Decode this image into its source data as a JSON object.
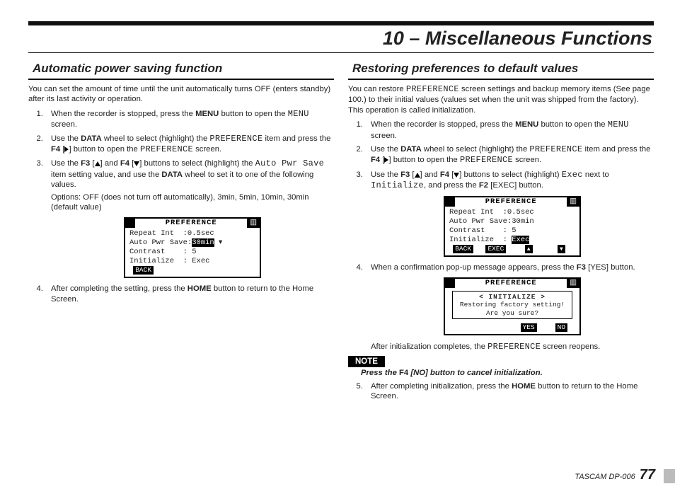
{
  "page_title": "10 – Miscellaneous Functions",
  "footer_model": "TASCAM  DP-006",
  "footer_page": "77",
  "left": {
    "heading": "Automatic power saving function",
    "intro": "You can set the amount of time until the unit automatically turns OFF (enters standby) after its last activity or operation.",
    "step1a": "When the recorder is stopped, press the ",
    "step1_menu": "MENU",
    "step1b": " button to open the ",
    "step1_lcd": "MENU",
    "step1c": " screen.",
    "step2a": "Use the ",
    "step2_data": "DATA",
    "step2b": " wheel to select (highlight) the ",
    "step2_pref": "PREFERENCE",
    "step2c": " item and press the ",
    "step2_f4": "F4",
    "step2d": " [",
    "step2e": "] button to open the ",
    "step2_pref2": "PREFERENCE",
    "step2f": " screen.",
    "step3a": "Use the ",
    "step3_f3": "F3",
    "step3b": " [",
    "step3c": "] and ",
    "step3_f4": "F4",
    "step3d": " [",
    "step3e": "] buttons to select (highlight) the ",
    "step3_aps": "Auto Pwr Save",
    "step3f": " item setting value, and use the ",
    "step3_data": "DATA",
    "step3g": " wheel to set it to one of the following values.",
    "step3_options": "Options: OFF (does not turn off automatically), 3min, 5min, 10min, 30min (default value)",
    "step4a": "After completing the setting, press the ",
    "step4_home": "HOME",
    "step4b": " button to return to the Home Screen.",
    "lcd": {
      "title": "PREFERENCE",
      "r1": "Repeat Int  :0.5sec",
      "r2a": "Auto Pwr Save:",
      "r2b": "30min",
      "r3": "Contrast    : 5",
      "r4": "Initialize  : Exec",
      "f1": "BACK"
    }
  },
  "right": {
    "heading": "Restoring preferences to default values",
    "intro1": "You can restore ",
    "intro_pref": "PREFERENCE",
    "intro2": " screen settings and backup memory items (See page 100.) to their initial values (values set when the unit was shipped from the factory). This operation is called initialization.",
    "step1a": "When the recorder is stopped, press the ",
    "step1_menu": "MENU",
    "step1b": " button to open the ",
    "step1_lcd": "MENU",
    "step1c": " screen.",
    "step2a": "Use the ",
    "step2_data": "DATA",
    "step2b": " wheel to select (highlight) the ",
    "step2_pref": "PREFERENCE",
    "step2c": " item and press the ",
    "step2_f4": "F4",
    "step2d": " [",
    "step2e": "] button to open the ",
    "step2_pref2": "PREFERENCE",
    "step2f": " screen.",
    "step3a": "Use the ",
    "step3_f3": "F3",
    "step3b": " [",
    "step3c": "] and ",
    "step3_f4": "F4",
    "step3d": " [",
    "step3e": "] buttons to select (highlight) ",
    "step3_exec": "Exec",
    "step3f": " next to ",
    "step3_init": "Initialize",
    "step3g": ", and press the ",
    "step3_f2": "F2",
    "step3h": " [EXEC] button.",
    "lcd1": {
      "title": "PREFERENCE",
      "r1": "Repeat Int  :0.5sec",
      "r2": "Auto Pwr Save:30min",
      "r3": "Contrast    : 5",
      "r4a": "Initialize  : ",
      "r4b": "Exec",
      "f1": "BACK",
      "f2": "EXEC"
    },
    "step4a": "When a confirmation pop-up message appears, press the ",
    "step4_f3": "F3",
    "step4b": " [YES] button.",
    "lcd2": {
      "title": "PREFERENCE",
      "p1": "< INITIALIZE >",
      "p2": "Restoring factory setting!",
      "p3": "Are you sure?",
      "y": "YES",
      "n": "NO"
    },
    "after_init_a": "After initialization completes, the ",
    "after_init_pref": "PREFERENCE",
    "after_init_b": " screen reopens.",
    "note_label": "NOTE",
    "note_a": "Press the ",
    "note_f4": "F4",
    "note_b": " [NO] button to cancel initialization.",
    "step5a": "After completing initialization, press the ",
    "step5_home": "HOME",
    "step5b": " button to return to the Home Screen."
  }
}
